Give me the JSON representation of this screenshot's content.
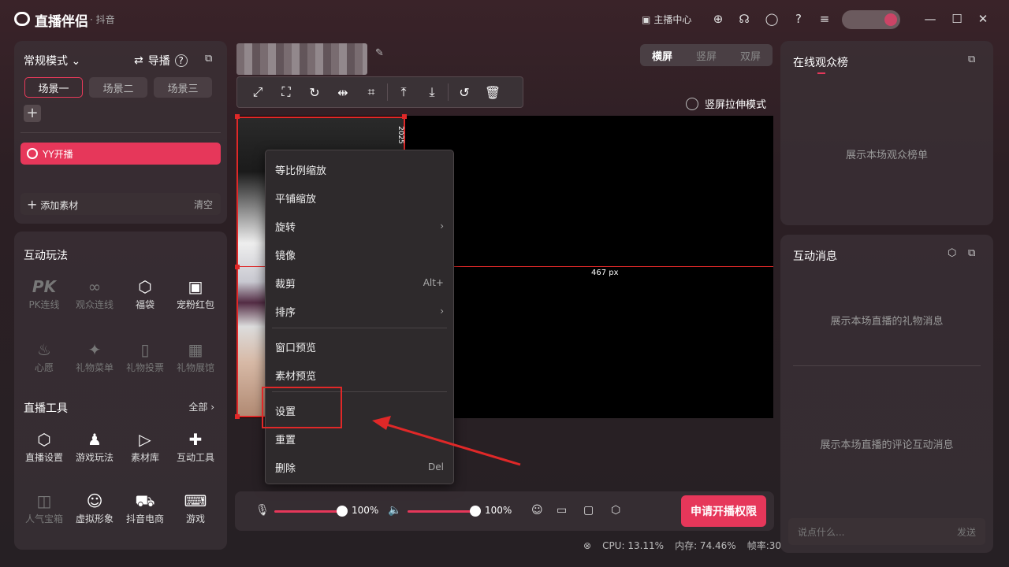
{
  "app": {
    "title": "直播伴侣",
    "subtitle": "· 抖音"
  },
  "titlebar": {
    "host_center": "主播中心",
    "icons": [
      "chart-icon",
      "upload-icon",
      "headset-icon",
      "chat-icon",
      "help-icon",
      "menu-icon",
      "minimize-icon",
      "maximize-icon",
      "close-icon"
    ]
  },
  "scenes": {
    "mode": "常规模式",
    "guide": "导播",
    "tabs": [
      "场景一",
      "场景二",
      "场景三"
    ],
    "active_tab": 0,
    "sources": [
      {
        "label": "YY开播",
        "icon": "camera-icon"
      }
    ],
    "add_material": "添加素材",
    "clear": "清空"
  },
  "interactive": {
    "title": "互动玩法",
    "items": [
      {
        "label": "PK连线",
        "icon": "pk-icon",
        "enabled": false
      },
      {
        "label": "观众连线",
        "icon": "link-icon",
        "enabled": false
      },
      {
        "label": "福袋",
        "icon": "luckybag-icon",
        "enabled": true
      },
      {
        "label": "宠粉红包",
        "icon": "redpacket-icon",
        "enabled": true
      },
      {
        "label": "心愿",
        "icon": "wish-icon",
        "enabled": false
      },
      {
        "label": "礼物菜单",
        "icon": "giftmenu-icon",
        "enabled": false
      },
      {
        "label": "礼物投票",
        "icon": "vote-icon",
        "enabled": false
      },
      {
        "label": "礼物展馆",
        "icon": "gallery-icon",
        "enabled": false
      }
    ]
  },
  "tools": {
    "title": "直播工具",
    "all": "全部",
    "items": [
      {
        "label": "直播设置",
        "icon": "settings-icon",
        "enabled": true
      },
      {
        "label": "游戏玩法",
        "icon": "joystick-icon",
        "enabled": true
      },
      {
        "label": "素材库",
        "icon": "library-icon",
        "enabled": true
      },
      {
        "label": "互动工具",
        "icon": "puzzle-icon",
        "enabled": true
      },
      {
        "label": "人气宝箱",
        "icon": "chest-icon",
        "enabled": false
      },
      {
        "label": "虚拟形象",
        "icon": "avatar-icon",
        "enabled": true
      },
      {
        "label": "抖音电商",
        "icon": "cart-icon",
        "enabled": true
      },
      {
        "label": "游戏",
        "icon": "gamepad-icon",
        "enabled": true
      }
    ]
  },
  "canvas": {
    "orientation": [
      "横屏",
      "竖屏",
      "双屏"
    ],
    "active_orientation": 0,
    "stretch_mode": "竖屏拉伸模式",
    "px_label": "467 px",
    "overlay_text": "2025"
  },
  "context_menu": {
    "items": [
      {
        "label": "等比例缩放",
        "shortcut": "",
        "submenu": false
      },
      {
        "label": "平铺缩放",
        "shortcut": "",
        "submenu": false
      },
      {
        "label": "旋转",
        "shortcut": "",
        "submenu": true
      },
      {
        "label": "镜像",
        "shortcut": "",
        "submenu": false
      },
      {
        "label": "裁剪",
        "shortcut": "Alt+",
        "submenu": false
      },
      {
        "label": "排序",
        "shortcut": "",
        "submenu": true
      },
      {
        "label": "窗口预览",
        "shortcut": "",
        "submenu": false
      },
      {
        "label": "素材预览",
        "shortcut": "",
        "submenu": false
      },
      {
        "label": "设置",
        "shortcut": "",
        "submenu": false
      },
      {
        "label": "重置",
        "shortcut": "",
        "submenu": false
      },
      {
        "label": "删除",
        "shortcut": "Del",
        "submenu": false
      }
    ]
  },
  "controls": {
    "mic_volume": "100%",
    "speaker_volume": "100%",
    "mic_level": 1.0,
    "speaker_level": 1.0,
    "apply_button": "申请开播权限"
  },
  "status": {
    "cpu": "CPU: 13.11%",
    "memory": "内存: 74.46%",
    "fps": "帧率:30"
  },
  "right": {
    "rank_title": "在线观众榜",
    "rank_empty": "展示本场观众榜单",
    "msg_title": "互动消息",
    "gift_empty": "展示本场直播的礼物消息",
    "comment_empty": "展示本场直播的评论互动消息",
    "input_placeholder": "说点什么...",
    "send": "发送"
  },
  "colors": {
    "accent": "#e6375a",
    "selection": "#e02828"
  }
}
